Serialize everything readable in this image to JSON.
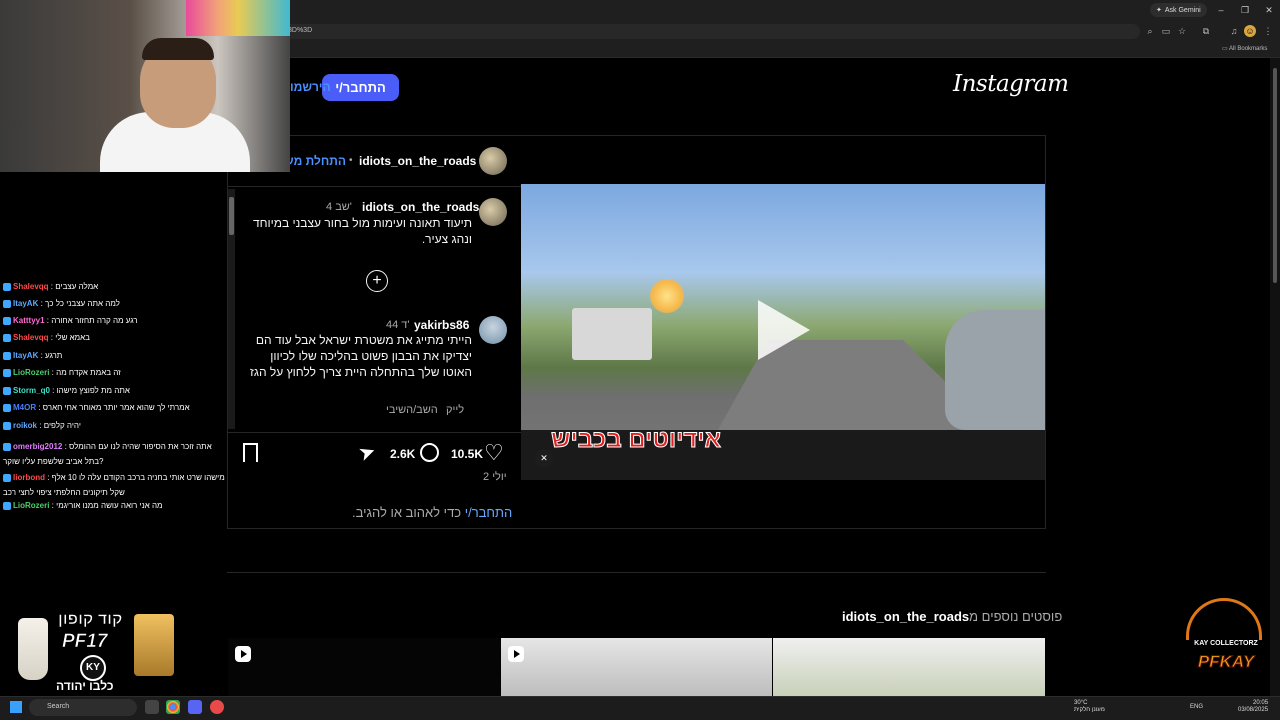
{
  "browser": {
    "ask_gemini": "Ask Gemini",
    "url_fragment": "3D%3D",
    "all_bookmarks": "All Bookmarks"
  },
  "instagram": {
    "logo": "Instagram",
    "login_button": "התחבר/י",
    "signup_link": "הירשמו"
  },
  "post": {
    "username": "idiots_on_the_roads",
    "header_separator": "•",
    "follow_text": "התחלת מעקב",
    "video_caption": "אידיוטים בכביש",
    "caption": {
      "username": "idiots_on_the_roads",
      "time": "4 שב'",
      "text": "תיעוד תאונה ועימות מול בחור עצבני במיוחד ונהג צעיר."
    },
    "comment": {
      "username": "yakirbs86",
      "time": "44 ד'",
      "text": "הייתי מתייג את משטרת ישראל אבל עוד הם יצדיקו את הבבון פשוט בהליכה שלו לכיוון האוטו שלך בהתחלה היית צריך ללחוץ על הגז",
      "like_label": "לייק",
      "reply_label": "השב/השיבי"
    },
    "likes": "10.5K",
    "comments_count": "2.6K",
    "date": "2 יולי",
    "login_prompt_link": "התחבר/י",
    "login_prompt_text": " כדי לאהוב או להגיב."
  },
  "more_posts": {
    "prefix": "פוסטים נוספים מ",
    "username": "idiots_on_the_roads"
  },
  "stream_overlay": {
    "chat": [
      {
        "user": "",
        "text": "אמלה עצבים",
        "user_label": "Shalevqq",
        "color": "#ff4a4a"
      },
      {
        "user_label": "ItayAK",
        "text": "למה אתה עצבני כל כך",
        "color": "#5fa8ff"
      },
      {
        "user_label": "Katttyy1",
        "text": "רגע מה קרה תחזור אחורה",
        "color": "#ff6ad5"
      },
      {
        "user_label": "Shalevqq",
        "text": "באמא שלי",
        "color": "#ff4a4a"
      },
      {
        "user_label": "ItayAK",
        "text": "תרגע",
        "color": "#5fa8ff"
      },
      {
        "user_label": "LioRozeri",
        "text": "זה באמת אקדח מה",
        "color": "#4ad06a"
      },
      {
        "user_label": "Storm_q0",
        "text": "אתה מת לפוצץ מישהו",
        "color": "#3fe0c8"
      },
      {
        "user_label": "M4OR",
        "text": "אמרתי לך שהוא אמר יותר מאוחר אחי חארס",
        "color": "#4a7dff"
      },
      {
        "user_label": "roikok",
        "text": "יהיה קלפים",
        "color": "#5fa8ff"
      },
      {
        "user_label": "omerbig2012",
        "text": "אתה זוכר את הסיפור שהיה לנו עם ההומלס בתל אביב שלשפת עליו שוקר?",
        "color": "#e07cff"
      },
      {
        "user_label": "liorbond",
        "text": "מישהו שרט אותי בחניה ברכב הקודם עלה לו 10 אלף שקל תיקונים החלפתי ציפוי לחצי רכב",
        "color": "#ff4a4a"
      },
      {
        "user_label": "LioRozeri",
        "text": "מה אני רואה עושה ממנו אוריגמי",
        "color": "#4ad06a"
      }
    ],
    "promo_line1": "קוד קופון",
    "promo_line2": "PF17",
    "promo_badge": "KY",
    "promo_line3": "כלבו יהודה",
    "brand_sub": "KAY COLLECTORZ",
    "brand_name": "PFKAY"
  },
  "taskbar": {
    "search_placeholder": "Search",
    "weather_temp": "30°C",
    "weather_desc": "מעונן חלקית",
    "lang": "ENG",
    "time": "20:05",
    "date": "03/08/2025"
  }
}
